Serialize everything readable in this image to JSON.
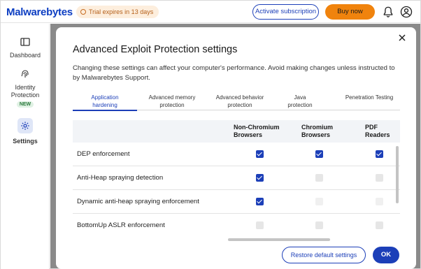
{
  "app": {
    "logo_text": "Malwarebytes",
    "trial_text": "Trial expires in 13 days",
    "activate_label": "Activate subscription",
    "buy_label": "Buy now"
  },
  "sidebar": {
    "items": [
      {
        "label": "Dashboard"
      },
      {
        "label": "Identity Protection",
        "badge": "NEW"
      },
      {
        "label": "Settings"
      }
    ]
  },
  "modal": {
    "title": "Advanced Exploit Protection settings",
    "description": "Changing these settings can affect your computer's performance. Avoid making changes unless instructed to by Malwarebytes Support.",
    "tabs": [
      {
        "label": "Application hardening",
        "active": true
      },
      {
        "label": "Advanced memory protection"
      },
      {
        "label": "Advanced behavior protection"
      },
      {
        "label": "Java protection"
      },
      {
        "label": "Penetration Testing"
      }
    ],
    "columns": [
      "Non-Chromium Browsers",
      "Chromium Browsers",
      "PDF Readers"
    ],
    "rows": [
      {
        "label": "DEP enforcement",
        "values": [
          "checked",
          "checked",
          "checked"
        ]
      },
      {
        "label": "Anti-Heap spraying detection",
        "values": [
          "checked",
          "unchecked",
          "unchecked"
        ]
      },
      {
        "label": "Dynamic anti-heap spraying enforcement",
        "values": [
          "checked",
          "unchecked",
          "unchecked"
        ]
      },
      {
        "label": "BottomUp ASLR enforcement",
        "values": [
          "unchecked",
          "unchecked",
          "unchecked"
        ]
      }
    ],
    "restore_label": "Restore default settings",
    "ok_label": "OK"
  },
  "colors": {
    "brand": "#0d3ec2",
    "accent": "#1c3fb8",
    "buy": "#f0830d",
    "trial_bg": "#fdeedd"
  }
}
